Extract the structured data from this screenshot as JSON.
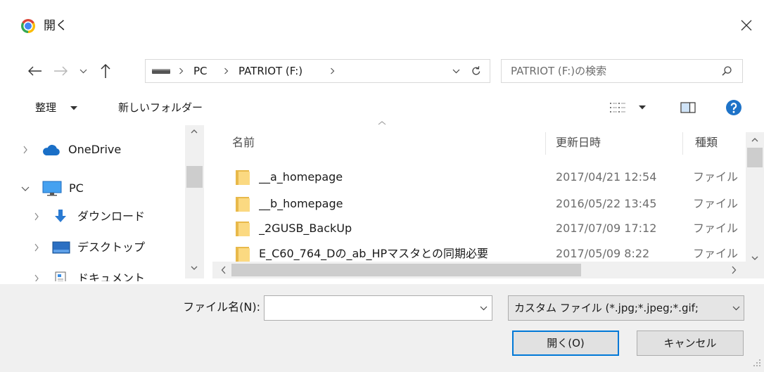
{
  "window": {
    "title": "開く",
    "app_icon": "chrome-icon",
    "close_icon": "close-icon"
  },
  "navigation_buttons": {
    "back_icon": "back-arrow-icon",
    "forward_icon": "forward-arrow-icon",
    "recent_icon": "chevron-down-icon",
    "up_icon": "up-arrow-icon"
  },
  "address_bar": {
    "drive_icon": "usb-drive-icon",
    "breadcrumb": [
      "PC",
      "PATRIOT (F:)"
    ],
    "history_icon": "chevron-down-icon",
    "refresh_icon": "refresh-icon"
  },
  "search": {
    "placeholder": "PATRIOT (F:)の検索",
    "icon": "search-icon"
  },
  "toolbar": {
    "organize_label": "整理",
    "new_folder_label": "新しいフォルダー",
    "view_icon": "details-view-icon",
    "preview_icon": "preview-pane-icon",
    "help_icon": "help-icon"
  },
  "nav_pane": {
    "items": [
      {
        "label": "OneDrive",
        "icon": "onedrive-cloud-icon",
        "expanded": false
      },
      {
        "label": "PC",
        "icon": "pc-monitor-icon",
        "expanded": true
      },
      {
        "label": "ダウンロード",
        "icon": "download-icon",
        "expanded": false
      },
      {
        "label": "デスクトップ",
        "icon": "desktop-icon",
        "expanded": false
      },
      {
        "label": "ドキュメント",
        "icon": "documents-icon",
        "expanded": false
      }
    ]
  },
  "file_list": {
    "columns": [
      "名前",
      "更新日時",
      "種類"
    ],
    "rows": [
      {
        "name": "__a_homepage",
        "modified": "2017/04/21 12:54",
        "type": "ファイル",
        "icon": "folder-icon"
      },
      {
        "name": "__b_homepage",
        "modified": "2016/05/22 13:45",
        "type": "ファイル",
        "icon": "folder-icon"
      },
      {
        "name": "_2GUSB_BackUp",
        "modified": "2017/07/09 17:12",
        "type": "ファイル",
        "icon": "folder-icon"
      },
      {
        "name": "E_C60_764_Dの_ab_HPマスタとの同期必要",
        "modified": "2017/05/09 8:22",
        "type": "ファイル",
        "icon": "folder-icon"
      }
    ]
  },
  "footer": {
    "file_name_label": "ファイル名(N):",
    "file_name_value": "",
    "file_type_selected": "カスタム ファイル (*.jpg;*.jpeg;*.gif;",
    "open_label": "開く(O)",
    "cancel_label": "キャンセル"
  },
  "colors": {
    "accent": "#0078d7",
    "help_blue": "#1e73c8",
    "onedrive_blue": "#1a6fc7",
    "folder_yellow": "#f8d775",
    "panel_bg": "#f0f0f0",
    "scroll_thumb": "#cdcdcd"
  }
}
